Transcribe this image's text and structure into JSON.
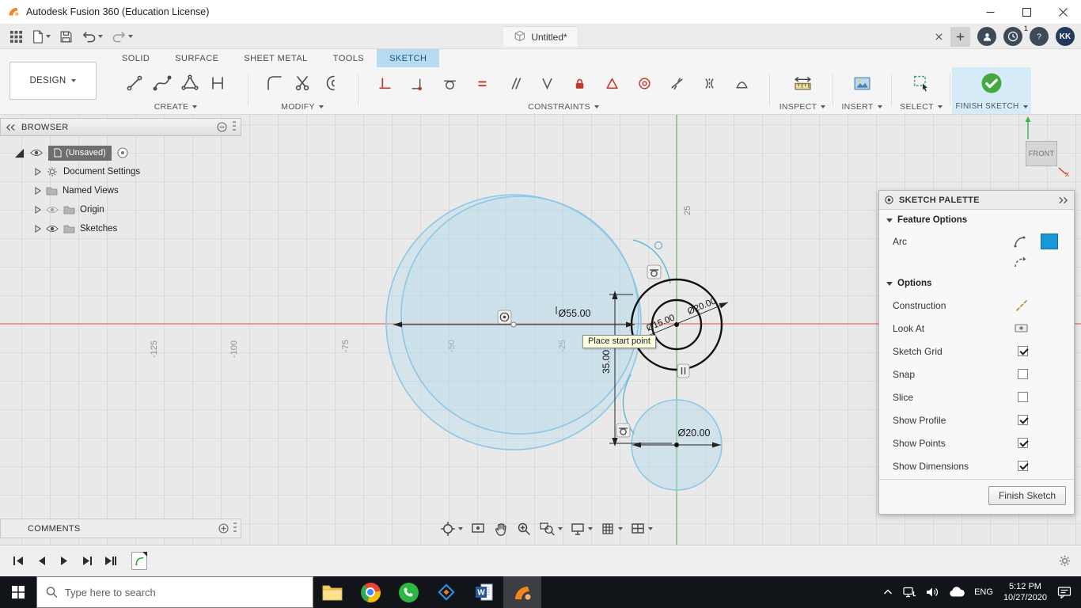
{
  "window": {
    "title": "Autodesk Fusion 360 (Education License)"
  },
  "appbar": {
    "tab_title": "Untitled*",
    "notification_badge": "1",
    "avatar_initials": "KK"
  },
  "ribbon": {
    "design_label": "DESIGN",
    "tabs": [
      {
        "label": "SOLID",
        "active": false
      },
      {
        "label": "SURFACE",
        "active": false
      },
      {
        "label": "SHEET METAL",
        "active": false
      },
      {
        "label": "TOOLS",
        "active": false
      },
      {
        "label": "SKETCH",
        "active": true
      }
    ],
    "groups": {
      "create": "CREATE",
      "modify": "MODIFY",
      "constraints": "CONSTRAINTS",
      "inspect": "INSPECT",
      "insert": "INSERT",
      "select": "SELECT",
      "finish_sketch": "FINISH SKETCH"
    }
  },
  "browser": {
    "title": "BROWSER",
    "root_label": "(Unsaved)",
    "items": [
      {
        "label": "Document Settings"
      },
      {
        "label": "Named Views"
      },
      {
        "label": "Origin"
      },
      {
        "label": "Sketches"
      }
    ],
    "comments_label": "COMMENTS"
  },
  "palette": {
    "title": "SKETCH PALETTE",
    "feature_options_header": "Feature Options",
    "feature_label": "Arc",
    "options_header": "Options",
    "options": [
      {
        "label": "Construction",
        "checked": false
      },
      {
        "label": "Look At",
        "checked": false
      },
      {
        "label": "Sketch Grid",
        "checked": true
      },
      {
        "label": "Snap",
        "checked": false
      },
      {
        "label": "Slice",
        "checked": false
      },
      {
        "label": "Show Profile",
        "checked": true
      },
      {
        "label": "Show Points",
        "checked": true
      },
      {
        "label": "Show Dimensions",
        "checked": true
      }
    ],
    "finish_button_label": "Finish Sketch"
  },
  "canvas": {
    "tooltip": "Place start point",
    "axis_x_labels": [
      "-125",
      "-100",
      "-75",
      "-50",
      "-25"
    ],
    "axis_y_label": "25",
    "dimensions": {
      "big_circle": "Ø55.00",
      "inner_circle": "Ø15.00",
      "outer_circle": "Ø20.00",
      "vertical": "35.00",
      "bottom_circle": "Ø20.00"
    },
    "viewcube_face": "FRONT",
    "viewcube_axis_x": "x"
  },
  "taskbar": {
    "search_placeholder": "Type here to search",
    "language": "ENG",
    "time": "5:12 PM",
    "date": "10/27/2020"
  }
}
